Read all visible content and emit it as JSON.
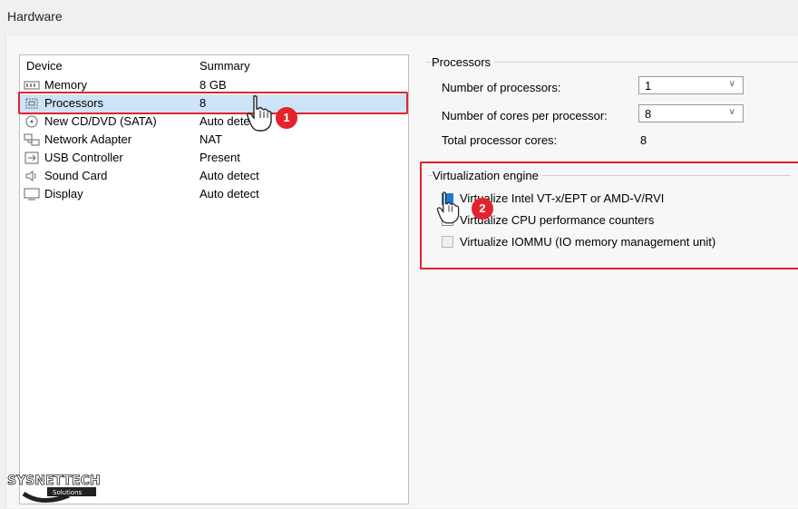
{
  "header": {
    "title": "Hardware"
  },
  "device_list": {
    "columns": {
      "device": "Device",
      "summary": "Summary"
    },
    "rows": [
      {
        "name": "Memory",
        "summary": "8 GB",
        "icon": "memory-icon"
      },
      {
        "name": "Processors",
        "summary": "8",
        "icon": "processor-icon",
        "selected": true
      },
      {
        "name": "New CD/DVD (SATA)",
        "summary": "Auto detect",
        "icon": "cd-dvd-icon"
      },
      {
        "name": "Network Adapter",
        "summary": "NAT",
        "icon": "network-icon"
      },
      {
        "name": "USB Controller",
        "summary": "Present",
        "icon": "usb-icon"
      },
      {
        "name": "Sound Card",
        "summary": "Auto detect",
        "icon": "speaker-icon"
      },
      {
        "name": "Display",
        "summary": "Auto detect",
        "icon": "display-icon"
      }
    ]
  },
  "processors": {
    "title": "Processors",
    "num_processors_label": "Number of processors:",
    "num_processors_value": "1",
    "cores_label": "Number of cores per processor:",
    "cores_value": "8",
    "total_label": "Total processor cores:",
    "total_value": "8"
  },
  "virtualization": {
    "title": "Virtualization engine",
    "options": [
      {
        "label": "Virtualize Intel VT-x/EPT or AMD-V/RVI",
        "checked": true
      },
      {
        "label": "Virtualize CPU performance counters",
        "checked": false
      },
      {
        "label": "Virtualize IOMMU (IO memory management unit)",
        "checked": false
      }
    ]
  },
  "annotations": {
    "step1": "1",
    "step2": "2",
    "color": "#e3222e"
  },
  "watermark": {
    "brand": "SYSNETTECH",
    "sub": "Solutions"
  }
}
